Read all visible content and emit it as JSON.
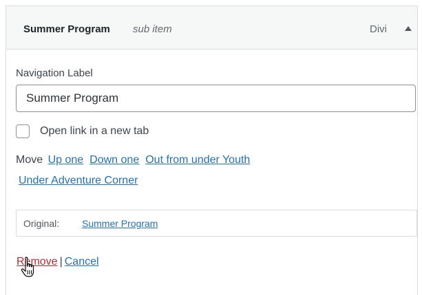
{
  "header": {
    "title": "Summer Program",
    "subtitle": "sub item",
    "item_type": "Divi",
    "toggle_icon": "triangle-up-icon"
  },
  "form": {
    "nav_label_heading": "Navigation Label",
    "nav_label_value": "Summer Program",
    "open_new_tab_label": "Open link in a new tab",
    "open_new_tab_checked": false
  },
  "move": {
    "label": "Move",
    "up_one": "Up one",
    "down_one": "Down one",
    "out_from_under": "Out from under Youth",
    "under_item": "Under Adventure Corner"
  },
  "original": {
    "label": "Original:",
    "link_text": "Summer Program"
  },
  "actions": {
    "remove": "Remove",
    "separator": "|",
    "cancel": "Cancel"
  },
  "cursor": {
    "icon": "hand-pointer-cursor-icon"
  },
  "colors": {
    "link": "#2271b1",
    "remove": "#b32d2e",
    "header_bg": "#f6f7f7",
    "border": "#dcdcde"
  }
}
